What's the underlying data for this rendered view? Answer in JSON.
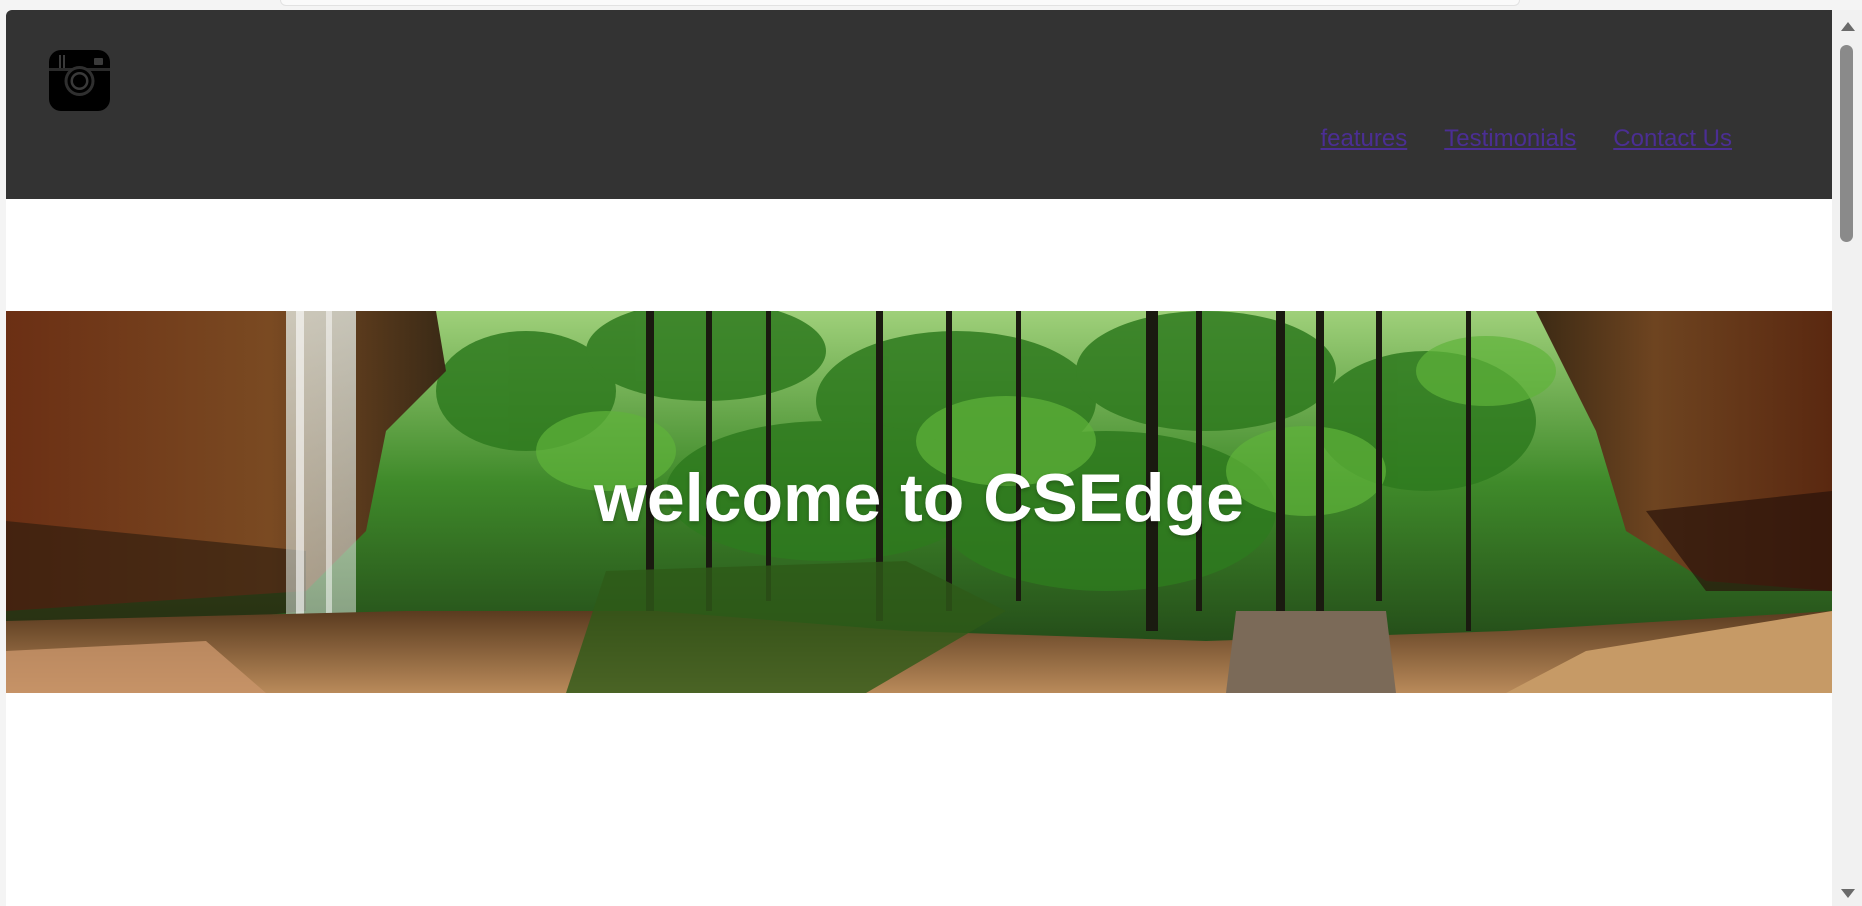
{
  "header": {
    "logo_icon": "camera-icon",
    "background": "#333333"
  },
  "nav": {
    "items": [
      {
        "label": "features"
      },
      {
        "label": "Testimonials"
      },
      {
        "label": "Contact Us"
      }
    ],
    "link_color": "#4b2e94"
  },
  "hero": {
    "title": "welcome to CSEdge",
    "image": "forest-waterfall-panorama"
  }
}
